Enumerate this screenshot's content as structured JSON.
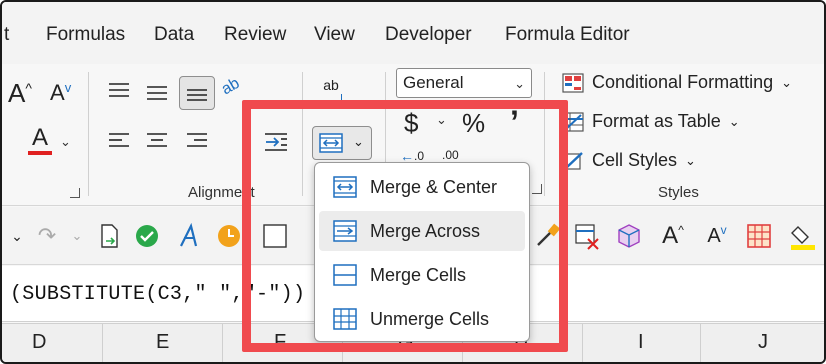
{
  "tabs": [
    "t",
    "Formulas",
    "Data",
    "Review",
    "View",
    "Developer",
    "Formula Editor"
  ],
  "alignment": {
    "group_label": "Alignment",
    "wrap_icon_label": "ab"
  },
  "number": {
    "format_value": "General",
    "currency_symbol": "$",
    "percent_symbol": "%",
    "comma_symbol": "’",
    "dec_increase": ".0",
    "dec_decrease": ".00"
  },
  "styles": {
    "group_label": "Styles",
    "conditional_formatting": "Conditional Formatting",
    "format_as_table": "Format as Table",
    "cell_styles": "Cell Styles"
  },
  "font_group": {
    "grow_label": "A",
    "shrink_label": "A",
    "font_color_label": "A"
  },
  "qat": {
    "grow_label": "A",
    "shrink_label": "A"
  },
  "formula_bar": {
    "text": "(SUBSTITUTE(C3,\" \",\"-\"))"
  },
  "columns": [
    "D",
    "E",
    "F",
    "G",
    "H",
    "I",
    "J"
  ],
  "merge_menu": {
    "items": [
      {
        "label": "Merge & Center",
        "icon": "merge-center-icon"
      },
      {
        "label": "Merge Across",
        "icon": "merge-across-icon"
      },
      {
        "label": "Merge Cells",
        "icon": "merge-cells-icon"
      },
      {
        "label": "Unmerge Cells",
        "icon": "unmerge-cells-icon"
      }
    ],
    "hovered_index": 1
  },
  "colors": {
    "highlight": "#f04a4e",
    "accent_blue": "#1f6fbf",
    "font_color_bar": "#e02020",
    "green_check": "#2aa84a",
    "orange_clock": "#f2a21b",
    "fill_yellow": "#ffe600"
  }
}
